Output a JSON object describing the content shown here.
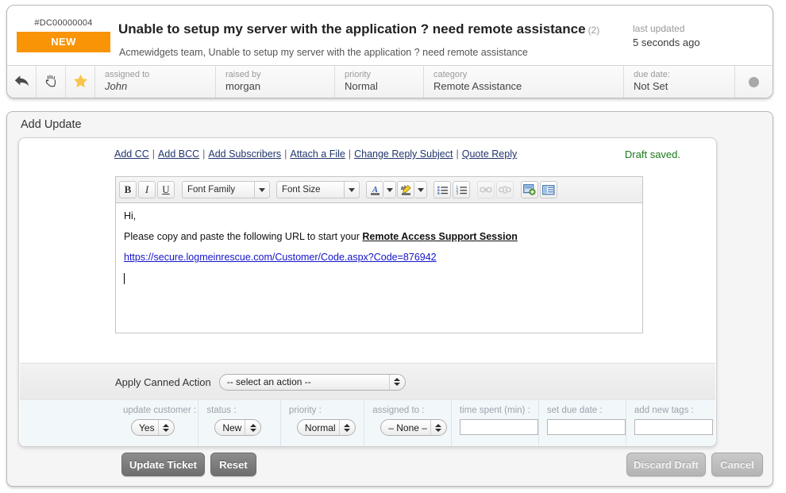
{
  "ticket": {
    "id": "#DC00000004",
    "status_badge": "NEW",
    "subject": "Unable to setup my server with the application ? need remote assistance",
    "subject_count": "(2)",
    "description": "Acmewidgets team, Unable to setup my server with the application ? need remote assistance",
    "last_updated_label": "last updated",
    "last_updated_value": "5 seconds ago",
    "meta": [
      {
        "label": "assigned to",
        "value": "John",
        "italic": true
      },
      {
        "label": "raised by",
        "value": "morgan",
        "italic": false
      },
      {
        "label": "priority",
        "value": "Normal",
        "italic": false
      },
      {
        "label": "category",
        "value": "Remote Assistance",
        "italic": false
      },
      {
        "label": "due date:",
        "value": "Not Set",
        "italic": false
      }
    ],
    "actions": {
      "reply": "reply-icon",
      "grab": "hand-icon",
      "favorite": "star-icon",
      "indicator": "status-dot-icon"
    },
    "badge_color": "#f89406"
  },
  "panel": {
    "title": "Add Update",
    "links": [
      "Add CC",
      "Add BCC",
      "Add Subscribers",
      "Attach a File",
      "Change Reply Subject",
      "Quote Reply"
    ],
    "separator": "|",
    "draft_status": "Draft saved.",
    "draft_status_color": "#1a7a1a"
  },
  "editor": {
    "toolbar": {
      "bold": "B",
      "italic": "I",
      "underline": "U",
      "font_family": "Font Family",
      "font_size": "Font Size",
      "font_color": "font-color-icon",
      "highlight_color": "highlight-color-icon",
      "bullet_list": "bullet-list-icon",
      "numbered_list": "numbered-list-icon",
      "insert_link": "link-icon",
      "unlink": "unlink-icon",
      "insert_image": "insert-image-icon",
      "insert_table": "insert-table-icon"
    },
    "content": {
      "line1": "Hi,",
      "line2_prefix": "Please copy and paste the following URL to start your ",
      "line2_strong": "Remote Access Support Session",
      "line3_url": "https://secure.logmeinrescue.com/Customer/Code.aspx?Code=876942"
    }
  },
  "canned": {
    "label": "Apply Canned Action",
    "value": "-- select an action --"
  },
  "fields": [
    {
      "label": "update customer :",
      "type": "select",
      "value": "Yes"
    },
    {
      "label": "status :",
      "type": "select",
      "value": "New"
    },
    {
      "label": "priority :",
      "type": "select",
      "value": "Normal"
    },
    {
      "label": "assigned to :",
      "type": "select",
      "value": "– None –"
    },
    {
      "label": "time spent (min) :",
      "type": "text",
      "value": ""
    },
    {
      "label": "set due date :",
      "type": "text",
      "value": ""
    },
    {
      "label": "add new tags :",
      "type": "text",
      "value": ""
    }
  ],
  "buttons": {
    "update": "Update Ticket",
    "reset": "Reset",
    "discard": "Discard Draft",
    "cancel": "Cancel"
  }
}
